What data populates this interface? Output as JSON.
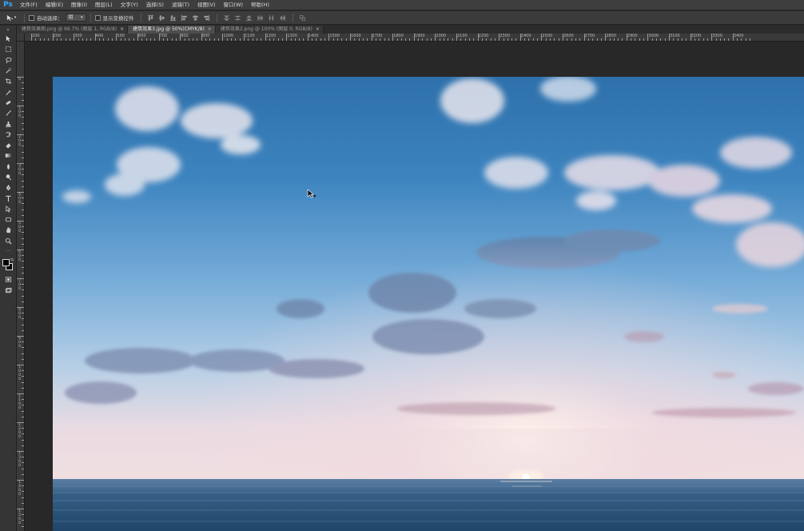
{
  "app": {
    "logo": "Ps"
  },
  "menubar": {
    "items": [
      "文件(F)",
      "编辑(E)",
      "图像(I)",
      "图层(L)",
      "文字(Y)",
      "选择(S)",
      "滤镜(T)",
      "视图(V)",
      "窗口(W)",
      "帮助(H)"
    ]
  },
  "optionsbar": {
    "tool_icon": "move-tool-icon",
    "auto_select_label": "自动选择：",
    "auto_select_value": "组",
    "show_transform_label": "显示变换控件"
  },
  "tabs": [
    {
      "label": "建筑效果图.png @ 66.7% (图层 1, RGB/8)",
      "close": "×",
      "active": false
    },
    {
      "label": "建筑效果3.jpg @ 50%(CMYK/8)",
      "close": "×",
      "active": true
    },
    {
      "label": "建筑效果2.png @ 100% (图层 0, RGB/8)",
      "close": "×",
      "active": false
    }
  ],
  "toolbox": {
    "tools": [
      "move-tool-icon",
      "marquee-tool-icon",
      "lasso-tool-icon",
      "quick-select-tool-icon",
      "crop-tool-icon",
      "eyedropper-tool-icon",
      "healing-brush-tool-icon",
      "brush-tool-icon",
      "clone-stamp-tool-icon",
      "history-brush-tool-icon",
      "eraser-tool-icon",
      "gradient-tool-icon",
      "blur-tool-icon",
      "dodge-tool-icon",
      "pen-tool-icon",
      "type-tool-icon",
      "path-select-tool-icon",
      "shape-tool-icon",
      "hand-tool-icon",
      "zoom-tool-icon"
    ],
    "foreground_color": "#000000",
    "background_color": "#000000"
  },
  "ruler_top": {
    "labels": [
      "100",
      "200",
      "300",
      "400",
      "500",
      "600",
      "700",
      "800",
      "900",
      "1000",
      "1100",
      "1200",
      "1300",
      "1400",
      "1500",
      "1600",
      "1700",
      "1800",
      "1900",
      "2000",
      "2100",
      "2200",
      "2300",
      "2400",
      "2500",
      "2600",
      "2700",
      "2800",
      "2900",
      "3000",
      "3100",
      "3200",
      "3300",
      "3400"
    ]
  },
  "ruler_left": {
    "labels": [
      "0",
      "1\n0\n0",
      "2\n0\n0",
      "3\n0\n0",
      "4\n0\n0",
      "5\n0\n0",
      "6\n0\n0",
      "7\n0\n0",
      "8\n0\n0",
      "9\n0\n0",
      "1\n0\n0\n0",
      "1\n1\n0\n0",
      "1\n2\n0\n0",
      "1\n3\n0\n0",
      "1\n4\n0\n0",
      "1\n5\n0\n0"
    ]
  },
  "document": {
    "image_description_icon": "sky-sea-sunset-photo",
    "colors": {
      "sky_top": "#2f72ad",
      "sky_mid": "#6ea6d4",
      "horizon": "#f2d8dc",
      "sea": "#2e5478"
    }
  }
}
